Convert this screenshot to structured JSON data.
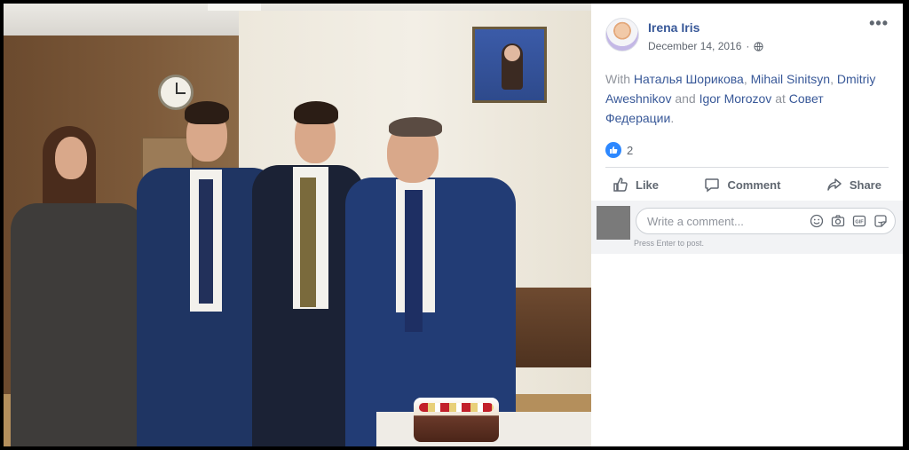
{
  "post": {
    "author": "Irena Iris",
    "date": "December 14, 2016",
    "date_separator": "·",
    "privacy_icon": "globe-icon",
    "more_label": "•••",
    "with_prefix": "With",
    "tagged_1": "Наталья Шорикова",
    "sep_1": ",",
    "tagged_2": "Mihail Sinitsyn",
    "sep_2": ",",
    "tagged_3": "Dmitriy Aweshnikov",
    "and_word": "and",
    "tagged_4": "Igor Morozov",
    "at_word": "at",
    "place": "Совет Федерации",
    "end_punct": ".",
    "reaction_count": "2"
  },
  "actions": {
    "like": "Like",
    "comment": "Comment",
    "share": "Share"
  },
  "comment_box": {
    "placeholder": "Write a comment...",
    "hint": "Press Enter to post."
  },
  "icons": [
    "emoji-icon",
    "camera-icon",
    "gif-icon",
    "sticker-icon"
  ],
  "colors": {
    "link": "#385898",
    "like_blue": "#2d88ff",
    "muted": "#606770"
  }
}
